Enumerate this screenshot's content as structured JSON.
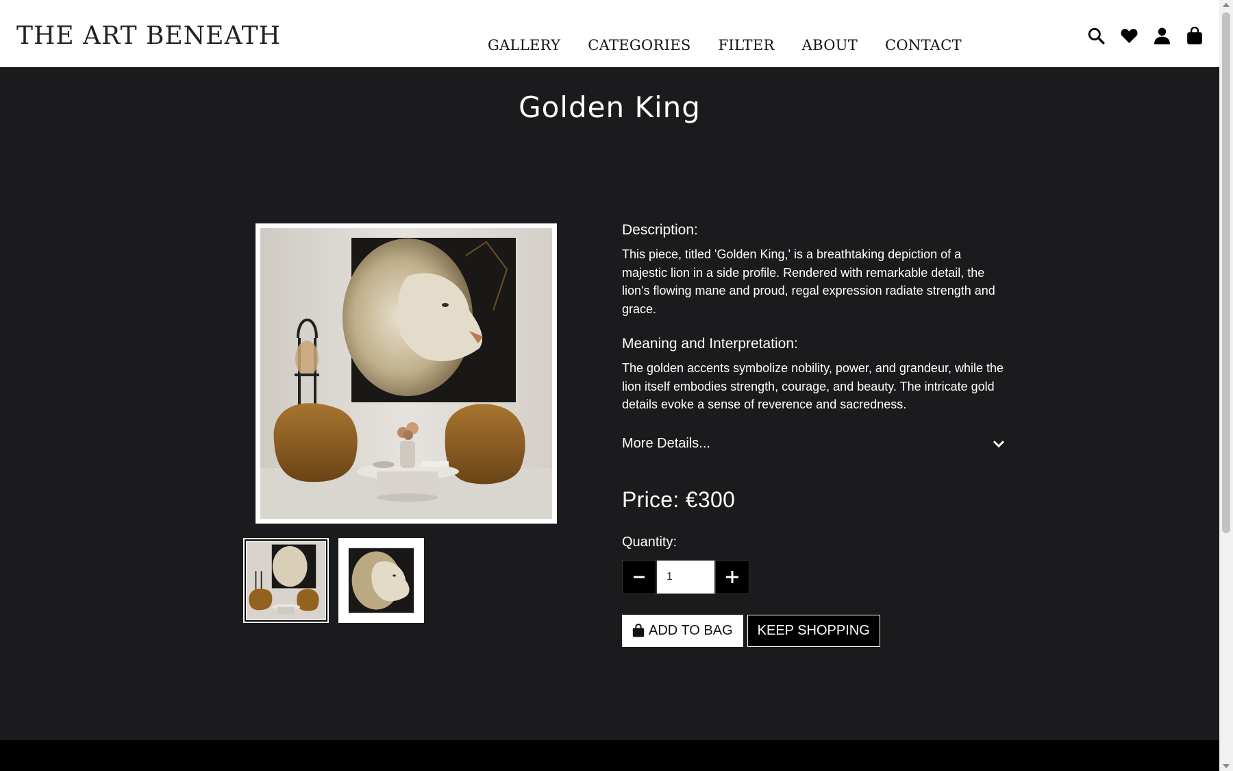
{
  "header": {
    "logo": "THE ART BENEATH",
    "nav": [
      "GALLERY",
      "CATEGORIES",
      "FILTER",
      "ABOUT",
      "CONTACT"
    ],
    "icons": [
      "search-icon",
      "heart-icon",
      "user-icon",
      "shopping-bag-icon"
    ]
  },
  "product": {
    "title": "Golden King",
    "description_label": "Description:",
    "description": "This piece, titled 'Golden King,' is a breathtaking depiction of a majestic lion in a side profile. Rendered with remarkable detail, the lion's flowing mane and proud, regal expression radiate strength and grace.",
    "meaning_label": "Meaning and Interpretation:",
    "meaning": "The golden accents symbolize nobility, power, and grandeur, while the lion itself embodies strength, courage, and beauty. The intricate gold details evoke a sense of reverence and sacredness.",
    "more_details": "More Details...",
    "price": "Price: €300",
    "quantity_label": "Quantity:",
    "quantity": "1",
    "add_to_bag": "ADD TO BAG",
    "keep_shopping": "KEEP SHOPPING"
  },
  "colors": {
    "background": "#1b1a1c",
    "header": "#ffffff",
    "accent": "#ffffff"
  }
}
